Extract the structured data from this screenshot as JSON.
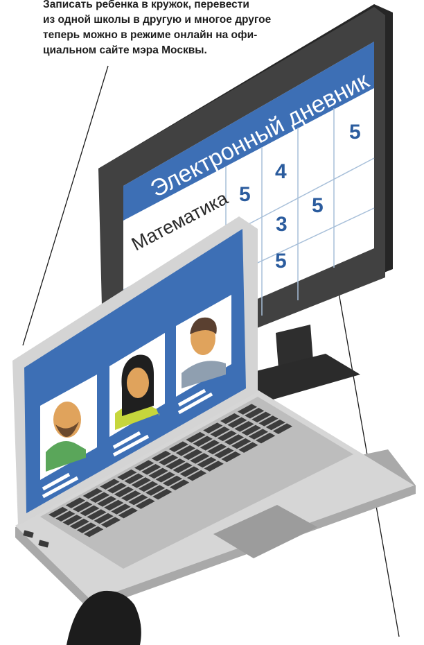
{
  "caption": {
    "lines": [
      "Записать ребенка в кружок, перевести",
      "из одной школы в другую и многое другое",
      "теперь можно в режиме онлайн на офи-",
      "циальном сайте мэра Москвы."
    ]
  },
  "monitor": {
    "diary_title": "Электронный дневник",
    "subject": "Математика",
    "grades": [
      "5",
      "4",
      "5",
      "3",
      "5",
      "5"
    ]
  },
  "laptop": {
    "profiles": [
      "man-with-beard",
      "woman",
      "man"
    ]
  },
  "colors": {
    "screen_blue": "#3d6fb5",
    "monitor_bezel": "#3b3b3b",
    "laptop_body": "#c9c9c9",
    "keyboard_key": "#3c3c3c",
    "grade_blue": "#2b5c9e"
  }
}
